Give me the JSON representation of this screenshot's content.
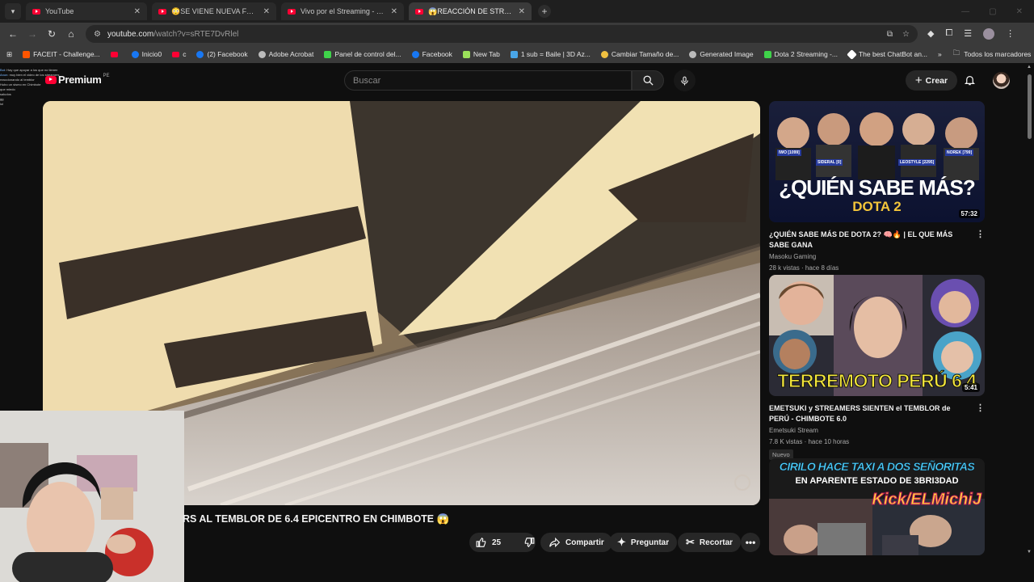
{
  "browser": {
    "tabs": [
      {
        "title": "YouTube",
        "active": false
      },
      {
        "title": "😳SE VIENE NUEVA FEKA HOU",
        "active": false
      },
      {
        "title": "Vivo por el Streaming - YouTub",
        "active": false
      },
      {
        "title": "😱REACCIÓN DE STREAMERS",
        "active": true
      }
    ],
    "url_host": "youtube.com",
    "url_path": "/watch?v=sRTE7DvRlel",
    "bookmarks": [
      {
        "label": "FACEIT - Challenge...",
        "color": "#ff5500"
      },
      {
        "label": "",
        "color": "#ff0033"
      },
      {
        "label": "Inicio0",
        "color": "#1877f2"
      },
      {
        "label": "c",
        "color": "#ff0033"
      },
      {
        "label": "(2) Facebook",
        "color": "#1877f2"
      },
      {
        "label": "Adobe Acrobat",
        "color": "#bbbbbb"
      },
      {
        "label": "Panel de control del...",
        "color": "#3fd34a"
      },
      {
        "label": "Facebook",
        "color": "#1877f2"
      },
      {
        "label": "New Tab",
        "color": "#9be05a"
      },
      {
        "label": "1 sub = Baile | 3D Az...",
        "color": "#49a6e8"
      },
      {
        "label": "Cambiar Tamaño de...",
        "color": "#f0c040"
      },
      {
        "label": "Generated Image",
        "color": "#bbbbbb"
      },
      {
        "label": "Dota 2 Streaming -...",
        "color": "#3fd34a"
      },
      {
        "label": "The best ChatBot an...",
        "color": "#ffffff"
      }
    ],
    "bookmarks_more": "»",
    "all_bookmarks": "Todos los marcadores"
  },
  "youtube": {
    "logo_text": "Premium",
    "logo_country": "PE",
    "search_placeholder": "Buscar",
    "create_label": "Crear",
    "video_title": "RS AL TEMBLOR DE 6.4 EPICENTRO EN CHIMBOTE 😱",
    "likes": "25",
    "share_label": "Compartir",
    "ask_label": "Preguntar",
    "clip_label": "Recortar"
  },
  "chat": [
    {
      "user": "Bot",
      "text": "Hay que apoyar a los que no tienen"
    },
    {
      "user": "Anon",
      "text": "muy bien el video de los streamers"
    },
    {
      "user": "",
      "text": "reaccionando al temblor"
    },
    {
      "user": "",
      "text": "Hubo un sismo en Chimbote"
    },
    {
      "user": "",
      "text": "que miedo"
    },
    {
      "user": "",
      "text": ""
    },
    {
      "user": "",
      "text": "saludos"
    },
    {
      "user": "",
      "text": "gg"
    },
    {
      "user": "",
      "text": "lol"
    }
  ],
  "recommendations": [
    {
      "title": "¿QUIÉN SABE MÁS DE DOTA 2? 🧠🔥 | EL QUE MÁS SABE GANA",
      "channel": "Masoku Gaming",
      "meta": "28 k vistas · hace 8 días",
      "duration": "57:32",
      "thumb_text": "¿QUIÉN SABE MÁS?",
      "thumb_sub": "DOTA 2",
      "thumb_names": [
        "IWO [1099]",
        "SIDERAL [0]",
        "LEOSTYLE [2295]",
        "NOREK [799]"
      ],
      "badge": ""
    },
    {
      "title": "EMETSUKI y STREAMERS SIENTEN el TEMBLOR de PERÚ - CHIMBOTE 6.0",
      "channel": "Emetsuki Stream",
      "meta": "7.8 K vistas · hace 10 horas",
      "duration": "5:41",
      "thumb_text": "TERREMOTO PERÚ 6.4",
      "badge": "Nuevo"
    },
    {
      "title": "",
      "channel": "",
      "meta": "",
      "duration": "",
      "thumb_text": "CIRILO HACE TAXI A DOS SEÑORITAS",
      "thumb_sub": "EN APARENTE ESTADO DE 3BRI3DAD",
      "thumb_tag": "Kick/ELMichiJ",
      "badge": ""
    }
  ]
}
